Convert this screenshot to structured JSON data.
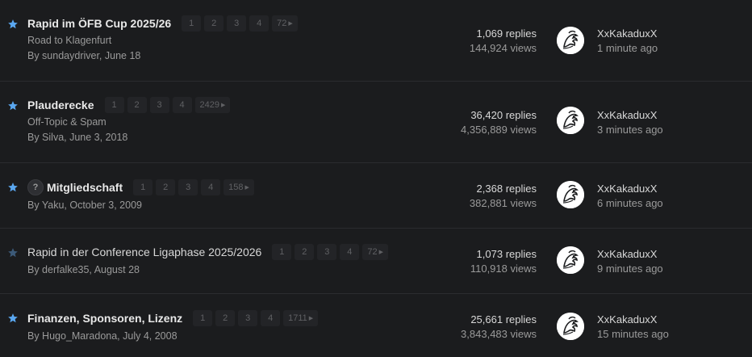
{
  "colors": {
    "star_active": "#5aa7f0",
    "star_inactive": "#3c5a78",
    "background": "#1b1c1e"
  },
  "topics": [
    {
      "title": "Rapid im ÖFB Cup 2025/26",
      "bold": true,
      "starred": true,
      "pages": [
        "1",
        "2",
        "3",
        "4",
        "72"
      ],
      "subtitle": "Road to Klagenfurt",
      "byline": "By sundaydriver, June 18",
      "replies": "1,069 replies",
      "views": "144,924 views",
      "last_user": "XxKakaduxX",
      "last_time": "1 minute ago",
      "avatar_icon": "avatar-cockatoo-icon"
    },
    {
      "title": "Plauderecke",
      "bold": true,
      "starred": true,
      "pages": [
        "1",
        "2",
        "3",
        "4",
        "2429"
      ],
      "subtitle": "Off-Topic & Spam",
      "byline": "By Silva, June 3, 2018",
      "replies": "36,420 replies",
      "views": "4,356,889 views",
      "last_user": "XxKakaduxX",
      "last_time": "3 minutes ago",
      "avatar_icon": "avatar-cockatoo-icon"
    },
    {
      "title": "Mitgliedschaft",
      "bold": true,
      "starred": true,
      "question_icon": "?",
      "pages": [
        "1",
        "2",
        "3",
        "4",
        "158"
      ],
      "subtitle": "",
      "byline": "By Yaku, October 3, 2009",
      "replies": "2,368 replies",
      "views": "382,881 views",
      "last_user": "XxKakaduxX",
      "last_time": "6 minutes ago",
      "avatar_icon": "avatar-cockatoo-icon"
    },
    {
      "title": "Rapid in der Conference Ligaphase 2025/2026",
      "bold": false,
      "starred": false,
      "pages": [
        "1",
        "2",
        "3",
        "4",
        "72"
      ],
      "subtitle": "",
      "byline": "By derfalke35, August 28",
      "replies": "1,073 replies",
      "views": "110,918 views",
      "last_user": "XxKakaduxX",
      "last_time": "9 minutes ago",
      "avatar_icon": "avatar-cockatoo-icon"
    },
    {
      "title": "Finanzen, Sponsoren, Lizenz",
      "bold": true,
      "starred": true,
      "pages": [
        "1",
        "2",
        "3",
        "4",
        "1711"
      ],
      "subtitle": "",
      "byline": "By Hugo_Maradona, July 4, 2008",
      "replies": "25,661 replies",
      "views": "3,843,483 views",
      "last_user": "XxKakaduxX",
      "last_time": "15 minutes ago",
      "avatar_icon": "avatar-cockatoo-icon"
    }
  ]
}
